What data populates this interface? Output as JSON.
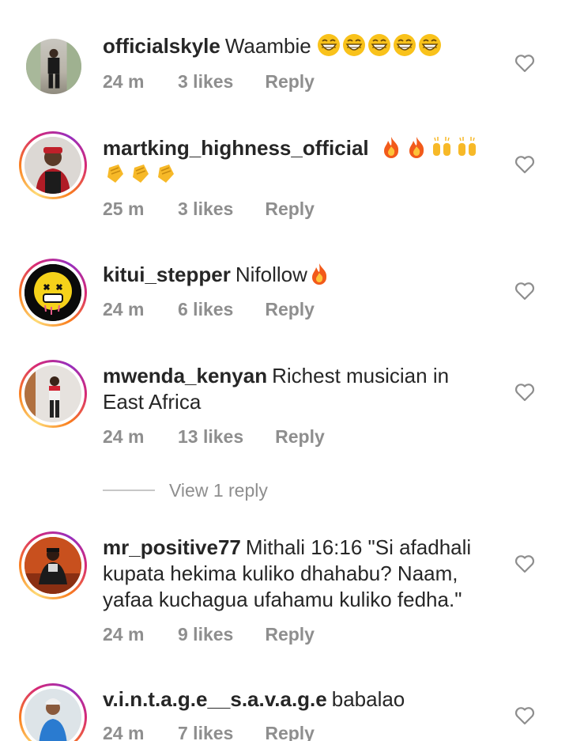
{
  "comments": [
    {
      "username": "officialskyle",
      "text": "Waambie",
      "time": "24 m",
      "likes": "3 likes",
      "reply": "Reply",
      "emojis": [
        "grinning-face",
        "grinning-face",
        "grinning-face",
        "grinning-face",
        "grinning-face"
      ]
    },
    {
      "username": "martking_highness_official",
      "text": "",
      "time": "25 m",
      "likes": "3 likes",
      "reply": "Reply",
      "emojis": [
        "fire",
        "fire",
        "raising-hands",
        "raising-hands",
        "clapping-hands",
        "clapping-hands",
        "clapping-hands"
      ]
    },
    {
      "username": "kitui_stepper",
      "text": "Nifollow",
      "time": "24 m",
      "likes": "6 likes",
      "reply": "Reply",
      "emojis": [
        "fire"
      ]
    },
    {
      "username": "mwenda_kenyan",
      "text": "Richest musician in East Africa",
      "time": "24 m",
      "likes": "13 likes",
      "reply": "Reply",
      "view_replies": "View 1 reply"
    },
    {
      "username": "mr_positive77",
      "text": "Mithali 16:16 \"Si afadhali kupata hekima kuliko dhahabu? Naam, yafaa kuchagua ufahamu kuliko fedha.\"",
      "time": "24 m",
      "likes": "9 likes",
      "reply": "Reply"
    },
    {
      "username": "v.i.n.t.a.g.e__s.a.v.a.g.e",
      "text": "babalao",
      "time": "24 m",
      "likes": "7 likes",
      "reply": "Reply"
    }
  ],
  "colors": {
    "text": "#262626",
    "muted": "#8e8e8e",
    "divider": "#c7c7c7"
  }
}
